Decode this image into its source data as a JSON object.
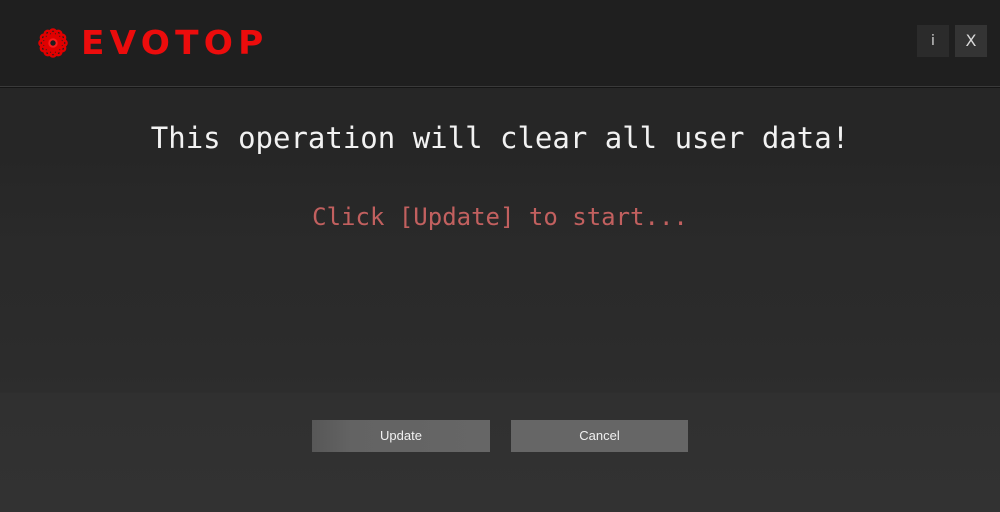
{
  "window": {
    "brand_name": "EVOTOP",
    "brand_color": "#ec0c0c",
    "logo_icon": "atom-logo-icon",
    "controls": [
      {
        "name": "info-button",
        "label": "i",
        "icon": "info-icon"
      },
      {
        "name": "close-button",
        "label": "X",
        "icon": "close-icon"
      }
    ]
  },
  "body": {
    "headline": "This operation will clear all user data!",
    "headline_color": "#f2f2f2",
    "subline": "Click [Update] to start...",
    "subline_color": "#c2605f"
  },
  "actions": {
    "update_label": "Update",
    "cancel_label": "Cancel",
    "button_color": "#636363"
  },
  "theme": {
    "header_background": "#1f1f1f",
    "body_background": "#2a2a2a",
    "footer_background": "#323232",
    "divider": "#3a3a3a"
  }
}
